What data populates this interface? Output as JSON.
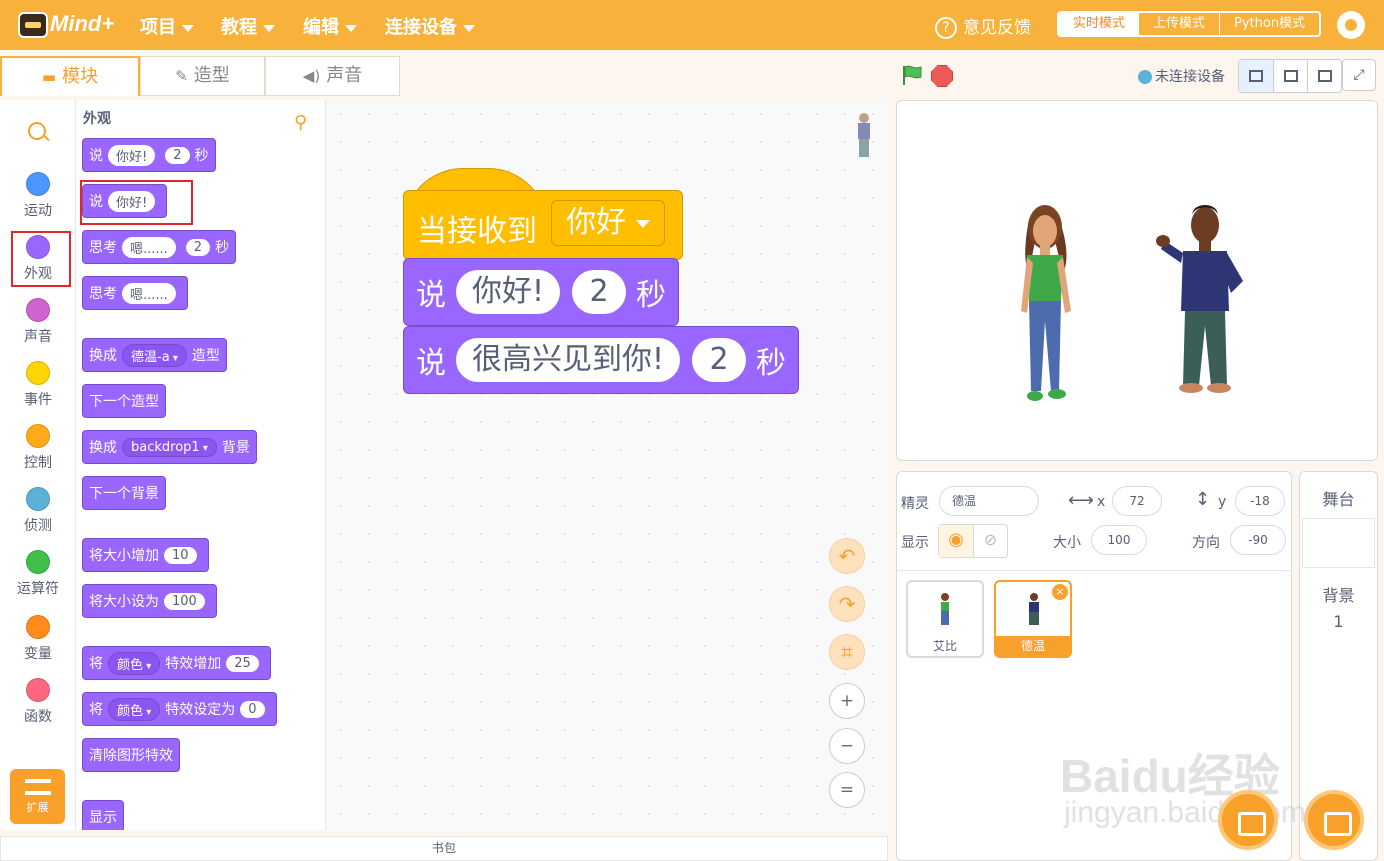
{
  "app": {
    "logo": "Mind+"
  },
  "menu": [
    {
      "label": "项目"
    },
    {
      "label": "教程"
    },
    {
      "label": "编辑"
    },
    {
      "label": "连接设备"
    }
  ],
  "header": {
    "feedback": "意见反馈",
    "modes": [
      "实时模式",
      "上传模式",
      "Python模式"
    ],
    "active_mode": "实时模式"
  },
  "editor_tabs": [
    {
      "label": "模块",
      "icon": "blocks-icon"
    },
    {
      "label": "造型",
      "icon": "brush-icon"
    },
    {
      "label": "声音",
      "icon": "speaker-icon"
    }
  ],
  "categories": [
    {
      "label": "运动",
      "color": "#4c97ff"
    },
    {
      "label": "外观",
      "color": "#9966ff"
    },
    {
      "label": "声音",
      "color": "#cf63cf"
    },
    {
      "label": "事件",
      "color": "#ffd500"
    },
    {
      "label": "控制",
      "color": "#ffab19"
    },
    {
      "label": "侦测",
      "color": "#5cb1d6"
    },
    {
      "label": "运算符",
      "color": "#40bf4a"
    },
    {
      "label": "变量",
      "color": "#ff8c1a"
    },
    {
      "label": "函数",
      "color": "#ff6680"
    }
  ],
  "extensions_label": "扩展",
  "palette": {
    "title": "外观",
    "blocks": {
      "say_secs": {
        "say": "说",
        "msg": "你好!",
        "secs": "2",
        "unit": "秒"
      },
      "say": {
        "say": "说",
        "msg": "你好!"
      },
      "think_secs": {
        "think": "思考",
        "msg": "嗯......",
        "secs": "2",
        "unit": "秒"
      },
      "think": {
        "think": "思考",
        "msg": "嗯......"
      },
      "switch_costume": {
        "pre": "换成",
        "value": "德温-a",
        "post": "造型"
      },
      "next_costume": "下一个造型",
      "switch_backdrop": {
        "pre": "换成",
        "value": "backdrop1",
        "post": "背景"
      },
      "next_backdrop": "下一个背景",
      "change_size": {
        "label": "将大小增加",
        "value": "10"
      },
      "set_size": {
        "label": "将大小设为",
        "value": "100"
      },
      "change_effect": {
        "pre": "将",
        "effect": "颜色",
        "mid": "特效增加",
        "value": "25"
      },
      "set_effect": {
        "pre": "将",
        "effect": "颜色",
        "mid": "特效设定为",
        "value": "0"
      },
      "clear_effects": "清除图形特效",
      "show": "显示"
    }
  },
  "script": {
    "hat": {
      "label": "当接收到",
      "message": "你好"
    },
    "say1": {
      "say": "说",
      "msg": "你好!",
      "secs": "2",
      "unit": "秒"
    },
    "say2": {
      "say": "说",
      "msg": "很高兴见到你!",
      "secs": "2",
      "unit": "秒"
    }
  },
  "backpack": "书包",
  "stage_header": {
    "connection": "未连接设备"
  },
  "sprite_info": {
    "sprite_label": "精灵",
    "sprite_name": "德温",
    "x_label": "x",
    "x": "72",
    "y_label": "y",
    "y": "-18",
    "show_label": "显示",
    "size_label": "大小",
    "size": "100",
    "direction_label": "方向",
    "direction": "-90"
  },
  "sprites": [
    {
      "name": "艾比",
      "selected": false
    },
    {
      "name": "德温",
      "selected": true
    }
  ],
  "stage_panel": {
    "title": "舞台",
    "backdrops_label": "背景",
    "backdrops_count": "1"
  },
  "watermark": {
    "line1": "Baidu经验",
    "line2": "jingyan.baidu.com"
  }
}
